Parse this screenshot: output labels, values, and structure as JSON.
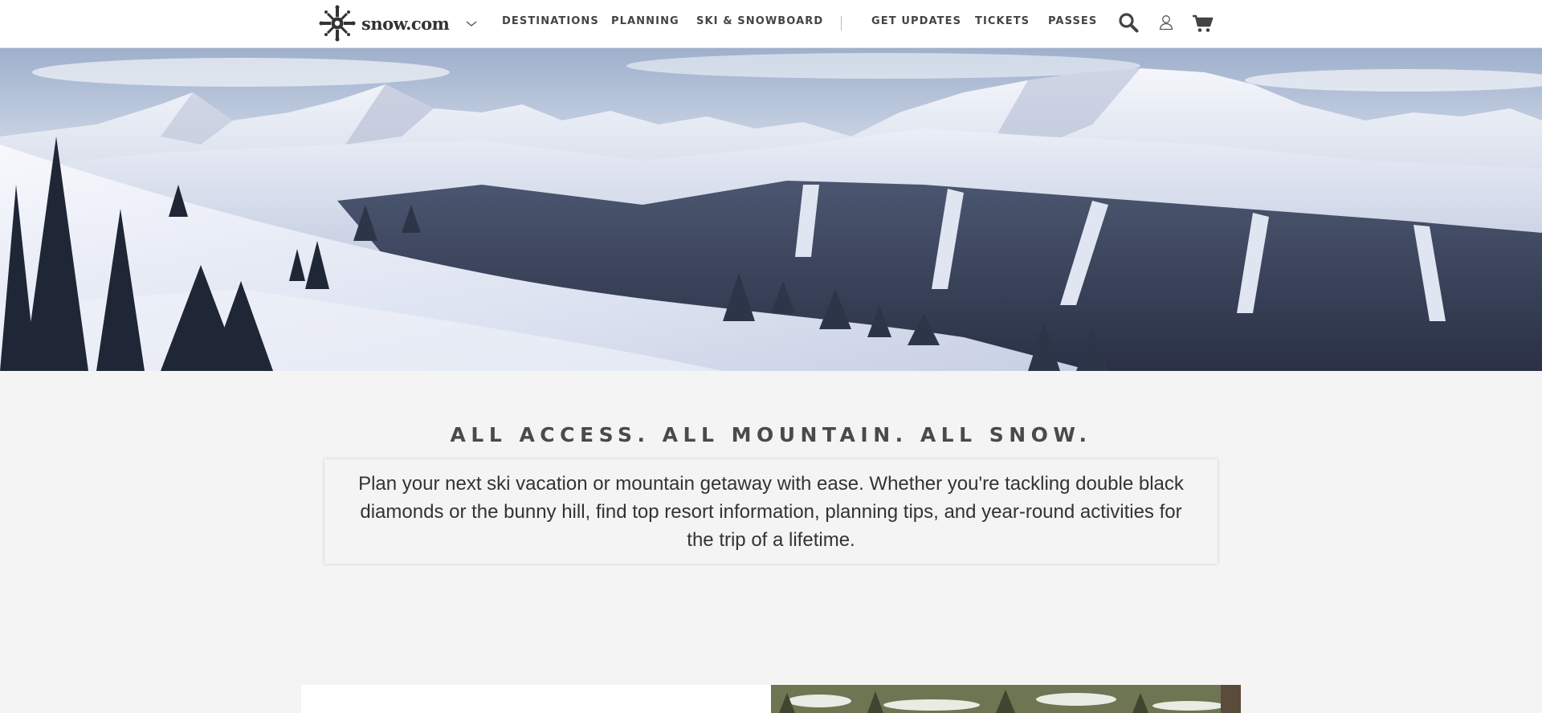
{
  "header": {
    "logo_text": "snow.com",
    "nav": {
      "destinations": "DESTINATIONS",
      "planning": "PLANNING",
      "ski_snowboard": "SKI & SNOWBOARD",
      "get_updates": "GET UPDATES",
      "tickets": "TICKETS",
      "passes": "PASSES"
    },
    "icons": [
      "snowflake-logo-icon",
      "chevron-down-icon",
      "search-icon",
      "user-icon",
      "cart-icon"
    ]
  },
  "hero": {
    "image": "snowy-mountain-panorama"
  },
  "intro": {
    "tagline": "ALL ACCESS. ALL MOUNTAIN. ALL SNOW.",
    "description": "Plan your next ski vacation or mountain getaway with ease. Whether you're tackling double black diamonds or the bunny hill, find top resort information, planning tips, and year-round activities for the trip of a lifetime."
  },
  "colors": {
    "header_bg": "#ffffff",
    "page_bg": "#f4f4f4",
    "text": "#444444"
  }
}
